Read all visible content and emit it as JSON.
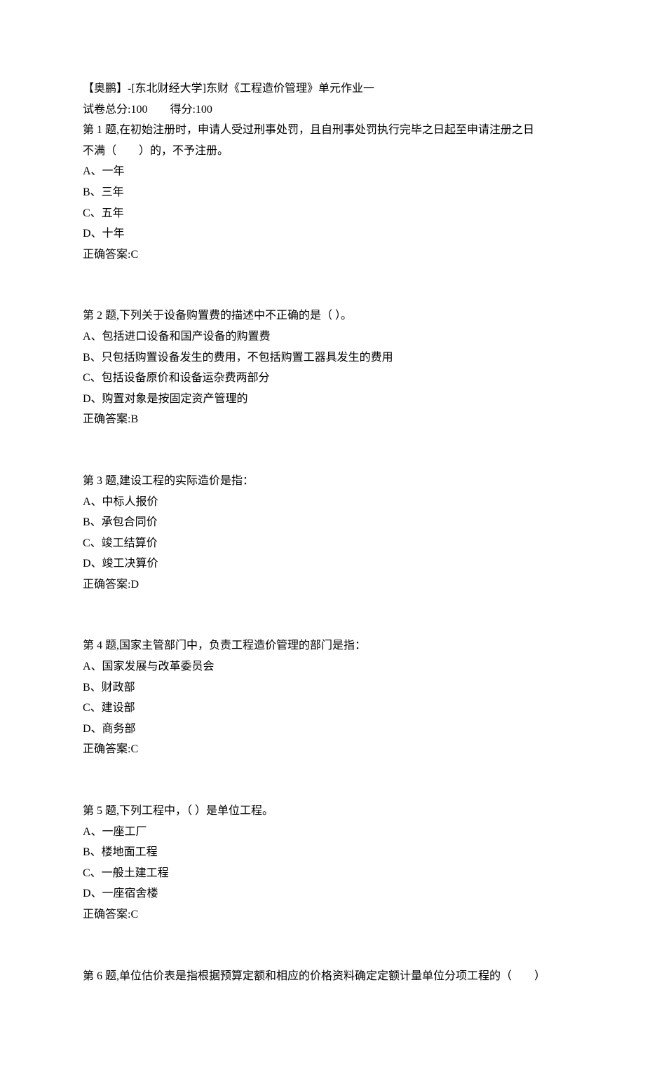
{
  "header": {
    "title": "【奥鹏】-[东北财经大学]东财《工程造价管理》单元作业一",
    "total_score_label": "试卷总分:100",
    "got_score_label": "得分:100"
  },
  "questions": [
    {
      "prompt_line1": "第 1 题,在初始注册时，申请人受过刑事处罚，且自刑事处罚执行完毕之日起至申请注册之日",
      "prompt_line2": "不满（　　）的，不予注册。",
      "options": [
        "A、一年",
        "B、三年",
        "C、五年",
        "D、十年"
      ],
      "answer": "正确答案:C"
    },
    {
      "prompt_line1": "第 2 题,下列关于设备购置费的描述中不正确的是（ ）。",
      "options": [
        "A、包括进口设备和国产设备的购置费",
        "B、只包括购置设备发生的费用，不包括购置工器具发生的费用",
        "C、包括设备原价和设备运杂费两部分",
        "D、购置对象是按固定资产管理的"
      ],
      "answer": "正确答案:B"
    },
    {
      "prompt_line1": "第 3 题,建设工程的实际造价是指：",
      "options": [
        "A、中标人报价",
        "B、承包合同价",
        "C、竣工结算价",
        "D、竣工决算价"
      ],
      "answer": "正确答案:D"
    },
    {
      "prompt_line1": "第 4 题,国家主管部门中，负责工程造价管理的部门是指：",
      "options": [
        "A、国家发展与改革委员会",
        "B、财政部",
        "C、建设部",
        "D、商务部"
      ],
      "answer": "正确答案:C"
    },
    {
      "prompt_line1": "第 5 题,下列工程中，（ ）是单位工程。",
      "options": [
        "A、一座工厂",
        "B、楼地面工程",
        "C、一般土建工程",
        "D、一座宿舍楼"
      ],
      "answer": "正确答案:C"
    },
    {
      "prompt_line1": "第 6 题,单位估价表是指根据预算定额和相应的价格资料确定定额计量单位分项工程的（　　）"
    }
  ]
}
